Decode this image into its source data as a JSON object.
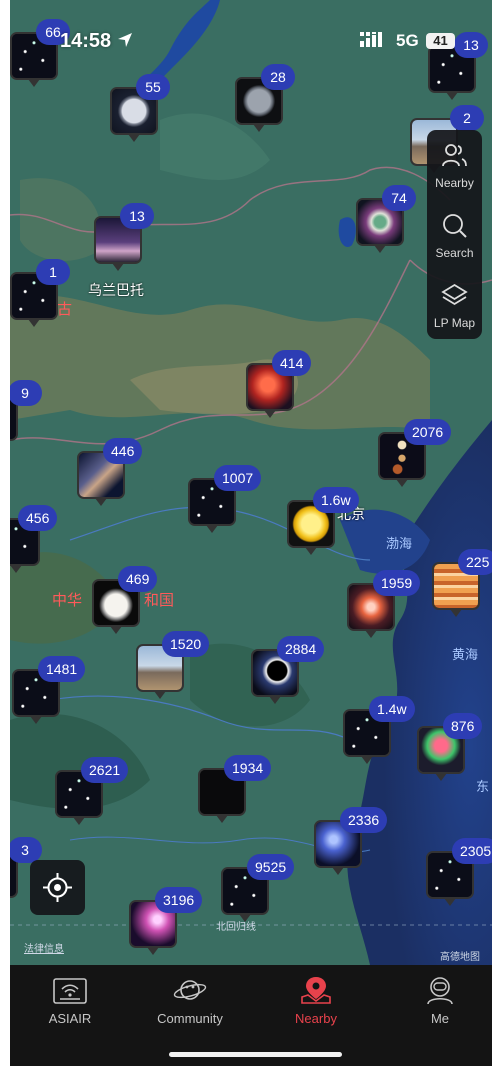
{
  "status_bar": {
    "time": "14:58",
    "carrier": "5G",
    "battery": "41"
  },
  "map": {
    "labels": {
      "ulaanbaatar": "乌兰巴托",
      "mongolia_fragment": "古",
      "china_left": "中华",
      "china_right": "和国",
      "beijing_fragment": "北京",
      "bohai": "渤海",
      "yellow_sea": "黄海",
      "east_fragment": "东",
      "tropic": "北回归线",
      "legal": "法律信息",
      "attribution": "高德地图"
    },
    "pins": [
      {
        "id": "p66",
        "count": "66",
        "thumb": "t-stars"
      },
      {
        "id": "p55",
        "count": "55",
        "thumb": "t-moon"
      },
      {
        "id": "p28",
        "count": "28",
        "thumb": "t-moongrey"
      },
      {
        "id": "p13a",
        "count": "13",
        "thumb": "t-stars"
      },
      {
        "id": "p2",
        "count": "2",
        "thumb": "t-landscape"
      },
      {
        "id": "p13b",
        "count": "13",
        "thumb": "t-purple"
      },
      {
        "id": "p74",
        "count": "74",
        "thumb": "t-neb-green"
      },
      {
        "id": "p1",
        "count": "1",
        "thumb": "t-stars"
      },
      {
        "id": "p414",
        "count": "414",
        "thumb": "t-neb-red"
      },
      {
        "id": "p9",
        "count": "9",
        "thumb": "t-stars"
      },
      {
        "id": "p2076",
        "count": "2076",
        "thumb": "t-phases"
      },
      {
        "id": "p446",
        "count": "446",
        "thumb": "t-mw"
      },
      {
        "id": "p1007",
        "count": "1007",
        "thumb": "t-stars"
      },
      {
        "id": "p16w",
        "count": "1.6w",
        "thumb": "t-sun"
      },
      {
        "id": "p456",
        "count": "456",
        "thumb": "t-stars"
      },
      {
        "id": "p469",
        "count": "469",
        "thumb": "t-moonwhite"
      },
      {
        "id": "p225",
        "count": "225",
        "thumb": "t-jupiter"
      },
      {
        "id": "p1959",
        "count": "1959",
        "thumb": "t-neb-orange"
      },
      {
        "id": "p1520",
        "count": "1520",
        "thumb": "t-landscape"
      },
      {
        "id": "p2884",
        "count": "2884",
        "thumb": "t-eclipse"
      },
      {
        "id": "p1481",
        "count": "1481",
        "thumb": "t-stars"
      },
      {
        "id": "p14w",
        "count": "1.4w",
        "thumb": "t-stars"
      },
      {
        "id": "p876",
        "count": "876",
        "thumb": "t-planet"
      },
      {
        "id": "p2621",
        "count": "2621",
        "thumb": "t-stars"
      },
      {
        "id": "p1934",
        "count": "1934",
        "thumb": "t-dark"
      },
      {
        "id": "p2336",
        "count": "2336",
        "thumb": "t-blue"
      },
      {
        "id": "p3",
        "count": "3",
        "thumb": "t-stars"
      },
      {
        "id": "p2305",
        "count": "2305",
        "thumb": "t-stars"
      },
      {
        "id": "p9525",
        "count": "9525",
        "thumb": "t-stars"
      },
      {
        "id": "p3196",
        "count": "3196",
        "thumb": "t-pink"
      }
    ]
  },
  "side_panel": {
    "nearby": "Nearby",
    "search": "Search",
    "lp_map": "LP Map"
  },
  "tabs": {
    "asiair": "ASIAIR",
    "community": "Community",
    "nearby": "Nearby",
    "me": "Me"
  },
  "colors": {
    "accent": "#e8424c",
    "badge": "#2d3db4"
  }
}
